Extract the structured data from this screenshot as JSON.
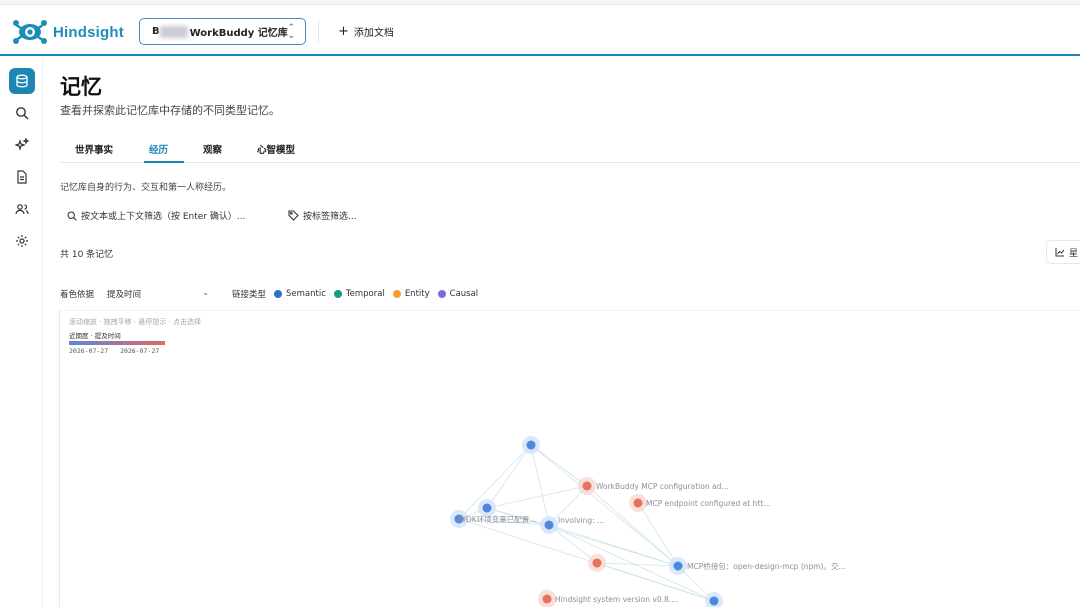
{
  "app": {
    "name": "Hindsight",
    "bank_prefix": "B",
    "bank_name": "WorkBuddy 记忆库",
    "add_doc": "添加文档"
  },
  "sidebar": {
    "items": [
      {
        "name": "memory",
        "icon": "database-icon",
        "active": true
      },
      {
        "name": "search",
        "icon": "search-icon",
        "active": false
      },
      {
        "name": "insights",
        "icon": "sparkles-icon",
        "active": false
      },
      {
        "name": "documents",
        "icon": "document-icon",
        "active": false
      },
      {
        "name": "entities",
        "icon": "users-icon",
        "active": false
      },
      {
        "name": "settings",
        "icon": "gear-icon",
        "active": false
      }
    ]
  },
  "page": {
    "title": "记忆",
    "subtitle": "查看并探索此记忆库中存储的不同类型记忆。",
    "tabs": [
      {
        "label": "世界事实",
        "active": false
      },
      {
        "label": "经历",
        "active": true
      },
      {
        "label": "观察",
        "active": false
      },
      {
        "label": "心智模型",
        "active": false
      }
    ],
    "description": "记忆库自身的行为、交互和第一人称经历。",
    "filter_text_placeholder": "按文本或上下文筛选（按 Enter 确认）...",
    "filter_tag_placeholder": "按标签筛选...",
    "count": "共 10 条记忆",
    "side_button": "星"
  },
  "graph_controls": {
    "color_by_label": "着色依据",
    "color_by_value": "提及时间",
    "link_type_label": "链接类型",
    "link_types": [
      {
        "name": "Semantic",
        "color": "#2f6fd0"
      },
      {
        "name": "Temporal",
        "color": "#159b86"
      },
      {
        "name": "Entity",
        "color": "#f0a030"
      },
      {
        "name": "Causal",
        "color": "#7a6ae6"
      }
    ]
  },
  "graph": {
    "hint": "滚动缩放 · 拖拽平移 · 悬停提示 · 点击选择",
    "scale_title": "近期度 · 提及时间",
    "scale_start": "2026-07-27",
    "scale_end": "2026-07-27",
    "colors": {
      "recent": "#e8735c",
      "old": "#4f86de",
      "halo_blue": "#cfe0f7",
      "halo_red": "#f7d6cf"
    },
    "nodes": [
      {
        "id": "n1",
        "label": "",
        "color": "old"
      },
      {
        "id": "n2",
        "label": "WorkBuddy MCP configuration ad...",
        "color": "recent"
      },
      {
        "id": "n3",
        "label": "MCP endpoint configured at htt...",
        "color": "recent"
      },
      {
        "id": "n4",
        "label": "",
        "color": "old"
      },
      {
        "id": "n5",
        "label": "BYOK环境变量已配置...",
        "color": "old"
      },
      {
        "id": "n6",
        "label": "Involving: ...",
        "color": "old"
      },
      {
        "id": "n7",
        "label": "",
        "color": "recent"
      },
      {
        "id": "n8",
        "label": "MCP桥接包：open-design-mcp (npm)。交...",
        "color": "old"
      },
      {
        "id": "n9",
        "label": "Hindsight system version v0.8....",
        "color": "recent"
      },
      {
        "id": "n10",
        "label": "",
        "color": "old"
      }
    ],
    "edges": [
      [
        "n1",
        "n4"
      ],
      [
        "n1",
        "n2"
      ],
      [
        "n1",
        "n5"
      ],
      [
        "n1",
        "n6"
      ],
      [
        "n1",
        "n8"
      ],
      [
        "n2",
        "n4"
      ],
      [
        "n2",
        "n6"
      ],
      [
        "n2",
        "n8"
      ],
      [
        "n4",
        "n5"
      ],
      [
        "n4",
        "n6"
      ],
      [
        "n4",
        "n8"
      ],
      [
        "n5",
        "n6"
      ],
      [
        "n6",
        "n8"
      ],
      [
        "n6",
        "n10"
      ],
      [
        "n7",
        "n8"
      ],
      [
        "n7",
        "n10"
      ],
      [
        "n8",
        "n10"
      ],
      [
        "n5",
        "n10"
      ],
      [
        "n6",
        "n7"
      ],
      [
        "n3",
        "n8"
      ]
    ]
  }
}
